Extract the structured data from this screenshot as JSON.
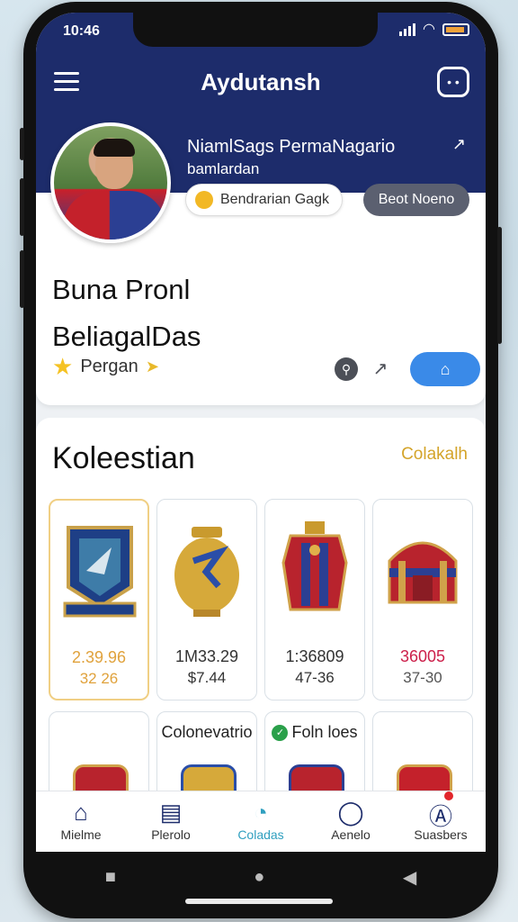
{
  "status_bar": {
    "time": "10:46"
  },
  "header": {
    "title": "Aydutansh",
    "bot_icon": "bot-icon"
  },
  "profile": {
    "name_line1": "NiamlSags PermaNagario",
    "name_line2": "bamlardan",
    "rank_chip": "Bendrarian Gagk",
    "status_chip": "Beot Noeno",
    "big_name_line1": "Buna Pronl",
    "big_name_line2": "BeliagalDas",
    "rank_label": "Pergan"
  },
  "collection": {
    "title": "Koleestian",
    "link": "Colakalh",
    "items": [
      {
        "price": "2.39.96",
        "sub": "32 26",
        "price_color": "#e0a23c",
        "sub_color": "#e0a23c",
        "selected": true,
        "art": "shield"
      },
      {
        "price": "1M33.29",
        "sub": "$7.44",
        "price_color": "#333333",
        "sub_color": "#333333",
        "selected": false,
        "art": "vase"
      },
      {
        "price": "1:36809",
        "sub": "47-36",
        "price_color": "#333333",
        "sub_color": "#333333",
        "selected": false,
        "art": "armor"
      },
      {
        "price": "36005",
        "sub": "37-30",
        "price_color": "#cc1f4a",
        "sub_color": "#555555",
        "selected": false,
        "art": "chest"
      }
    ],
    "row2": [
      {
        "label": ""
      },
      {
        "label": "Colonevatrio"
      },
      {
        "label": "Foln loes",
        "badge": true
      },
      {
        "label": ""
      }
    ]
  },
  "nav": [
    {
      "label": "Mielme",
      "icon": "home-icon"
    },
    {
      "label": "Plerolo",
      "icon": "document-icon"
    },
    {
      "label": "Coladas",
      "icon": "collection-icon",
      "active": true
    },
    {
      "label": "Aenelo",
      "icon": "chat-icon"
    },
    {
      "label": "Suasbers",
      "icon": "profile-icon"
    }
  ]
}
